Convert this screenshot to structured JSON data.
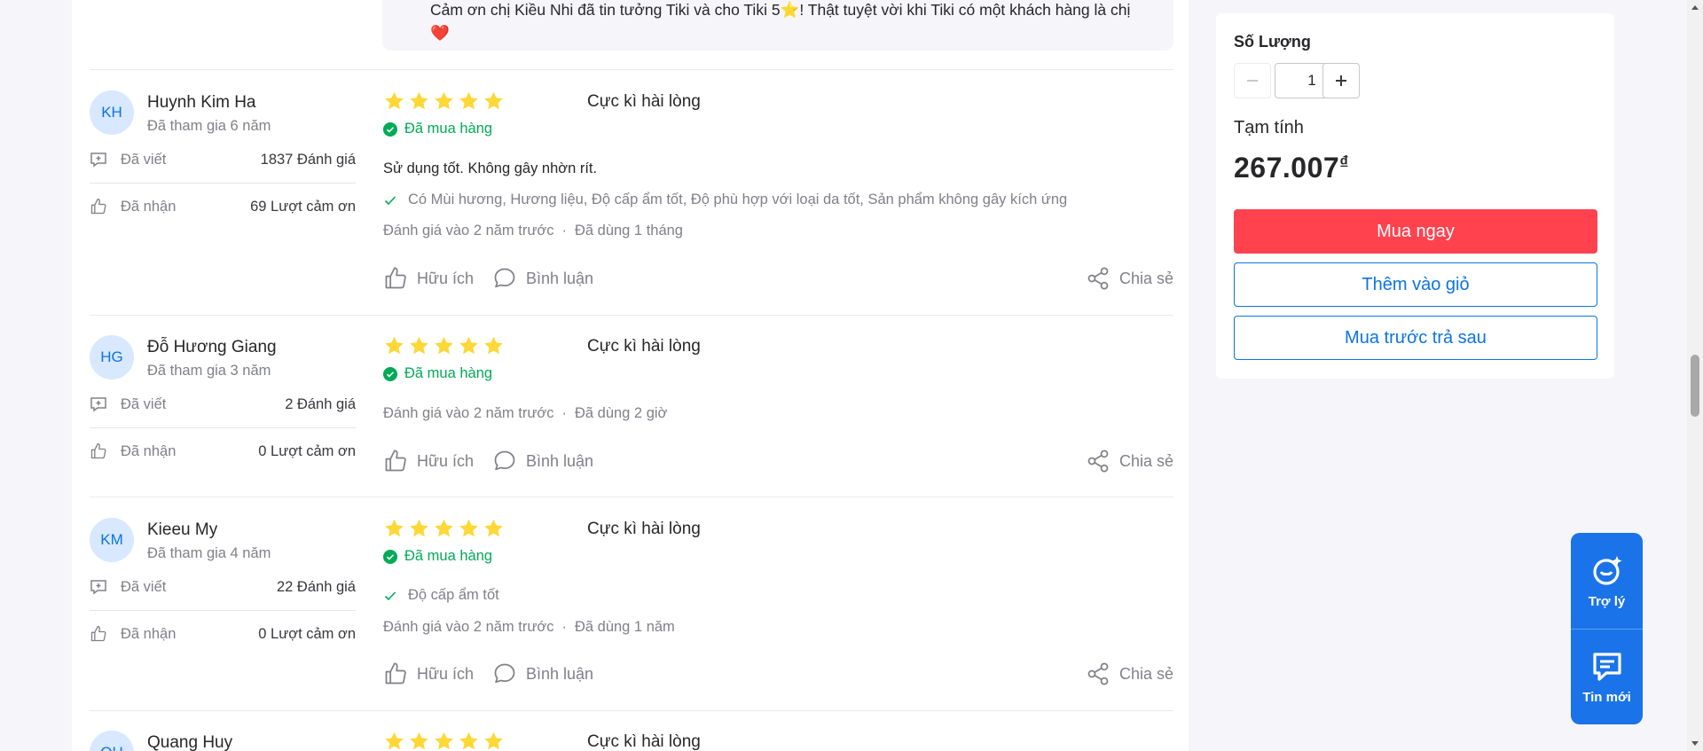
{
  "reply": {
    "text": "Cảm ơn chị Kiều Nhi đã tin tưởng Tiki và cho Tiki 5",
    "star": "⭐",
    "text2": "! Thật tuyệt vời khi Tiki có một khách hàng là chị",
    "heart": "❤️"
  },
  "reviews": [
    {
      "initials": "KH",
      "name": "Huynh Kim Ha",
      "joined": "Đã tham gia 6 năm",
      "written_label": "Đã viết",
      "written_value": "1837 Đánh giá",
      "received_label": "Đã nhận",
      "received_value": "69 Lượt cảm ơn",
      "rating": 5,
      "title": "Cực kì hài lòng",
      "bought": "Đã mua hàng",
      "text": "Sử dụng tốt. Không gây nhờn rít.",
      "attributes": "Có Mùi hương, Hương liệu, Độ cấp ẩm tốt, Độ phù hợp với loại da tốt, Sản phẩm không gây kích ứng",
      "reviewed": "Đánh giá vào 2 năm trước",
      "used": "Đã dùng 1 tháng",
      "helpful": "Hữu ích",
      "comment": "Bình luận",
      "share": "Chia sẻ"
    },
    {
      "initials": "HG",
      "name": "Đỗ Hương Giang",
      "joined": "Đã tham gia 3 năm",
      "written_label": "Đã viết",
      "written_value": "2 Đánh giá",
      "received_label": "Đã nhận",
      "received_value": "0 Lượt cảm ơn",
      "rating": 5,
      "title": "Cực kì hài lòng",
      "bought": "Đã mua hàng",
      "reviewed": "Đánh giá vào 2 năm trước",
      "used": "Đã dùng 2 giờ",
      "helpful": "Hữu ích",
      "comment": "Bình luận",
      "share": "Chia sẻ"
    },
    {
      "initials": "KM",
      "name": "Kieeu My",
      "joined": "Đã tham gia 4 năm",
      "written_label": "Đã viết",
      "written_value": "22 Đánh giá",
      "received_label": "Đã nhận",
      "received_value": "0 Lượt cảm ơn",
      "rating": 5,
      "title": "Cực kì hài lòng",
      "bought": "Đã mua hàng",
      "attributes": "Độ cấp ẩm tốt",
      "reviewed": "Đánh giá vào 2 năm trước",
      "used": "Đã dùng 1 năm",
      "helpful": "Hữu ích",
      "comment": "Bình luận",
      "share": "Chia sẻ"
    },
    {
      "initials": "QH",
      "name": "Quang Huy",
      "rating": 5,
      "title": "Cực kì hài lòng"
    }
  ],
  "sidebar": {
    "quantity_label": "Số Lượng",
    "quantity": "1",
    "subtotal_label": "Tạm tính",
    "price": "267.007",
    "currency": "₫",
    "buy_now": "Mua ngay",
    "add_to_cart": "Thêm vào giỏ",
    "buy_later": "Mua trước trả sau"
  },
  "float_widget": {
    "assistant": "Trợ lý",
    "messages": "Tin mới"
  },
  "colors": {
    "star": "#fdd836",
    "bought": "#00ab56",
    "buy_button": "#ff424e",
    "link_blue": "#0b74e5",
    "widget_blue": "#1a73e8"
  }
}
